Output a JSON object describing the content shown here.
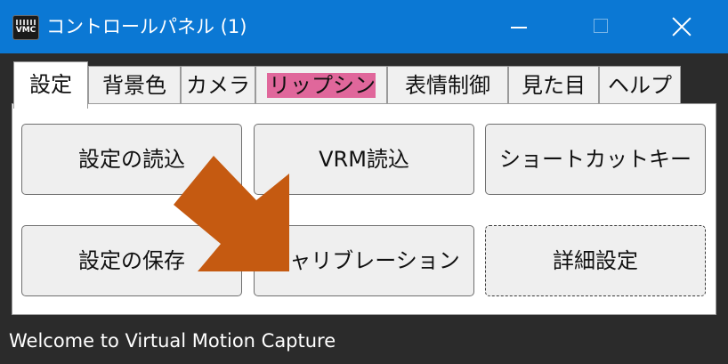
{
  "window": {
    "title": "コントロールパネル (1)",
    "app_icon_text": "VMC",
    "controls": [
      "minimize",
      "maximize",
      "close"
    ]
  },
  "tabs": [
    {
      "label": "設定",
      "active": true
    },
    {
      "label": "背景色"
    },
    {
      "label": "カメラ"
    },
    {
      "label": "リップシンク",
      "highlight": "#e0679b"
    },
    {
      "label": "表情制御"
    },
    {
      "label": "見た目"
    },
    {
      "label": "ヘルプ"
    }
  ],
  "buttons": [
    {
      "label": "設定の読込"
    },
    {
      "label": "VRM読込"
    },
    {
      "label": "ショートカットキー"
    },
    {
      "label": "設定の保存"
    },
    {
      "label": "キャリブレーション"
    },
    {
      "label": "詳細設定",
      "focused": true
    }
  ],
  "status_text": "Welcome to Virtual Motion Capture",
  "annotation": {
    "type": "arrow",
    "color": "#c55a11",
    "points_to": "キャリブレーション"
  },
  "colors": {
    "titlebar": "#0b78d4",
    "background": "#2b2b2b",
    "lip_tab_highlight": "#e0679b"
  }
}
